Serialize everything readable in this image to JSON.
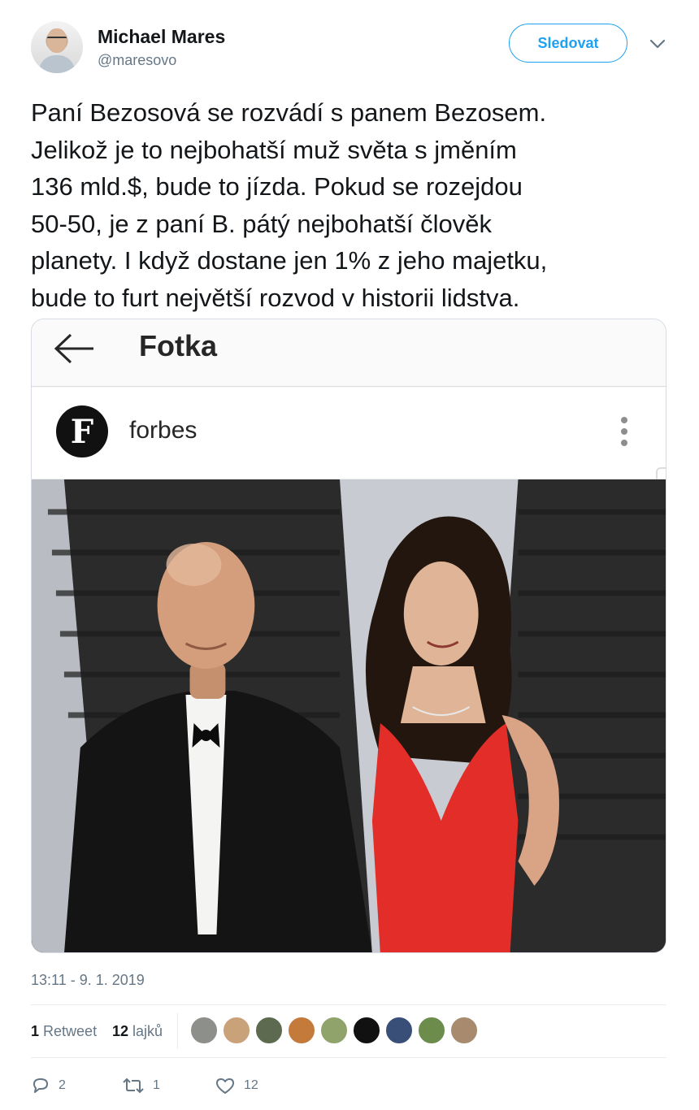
{
  "author": {
    "name": "Michael Mares",
    "handle": "@maresovo",
    "follow_label": "Sledovat"
  },
  "tweet": {
    "text_lines": [
      "Paní Bezosová se rozvádí s panem Bezosem.",
      "Jelikož je to nejbohatší muž světa s jměním",
      "136 mld.$, bude to jízda. Pokud se rozejdou",
      "50-50, je z paní B. pátý nejbohatší člověk",
      "planety. I když dostane jen 1% z jeho majetku,",
      "bude to furt největší rozvod v historii lidstva."
    ],
    "timestamp": "13:11 - 9. 1. 2019"
  },
  "media": {
    "screen_title": "Fotka",
    "account_name": "forbes",
    "logo_letter": "F"
  },
  "stats": {
    "retweets_count": "1",
    "retweets_label": "Retweet",
    "likes_count": "12",
    "likes_label": "lajků",
    "liker_colors": [
      "#8c8f8a",
      "#c9a27a",
      "#5e6a4f",
      "#c47a3a",
      "#8fa36a",
      "#111111",
      "#3a4f78",
      "#6b8c4a",
      "#a88a6e"
    ]
  },
  "actions": {
    "replies": "2",
    "retweets": "1",
    "likes": "12"
  },
  "colors": {
    "accent": "#1da1f2",
    "secondary_text": "#657786"
  }
}
